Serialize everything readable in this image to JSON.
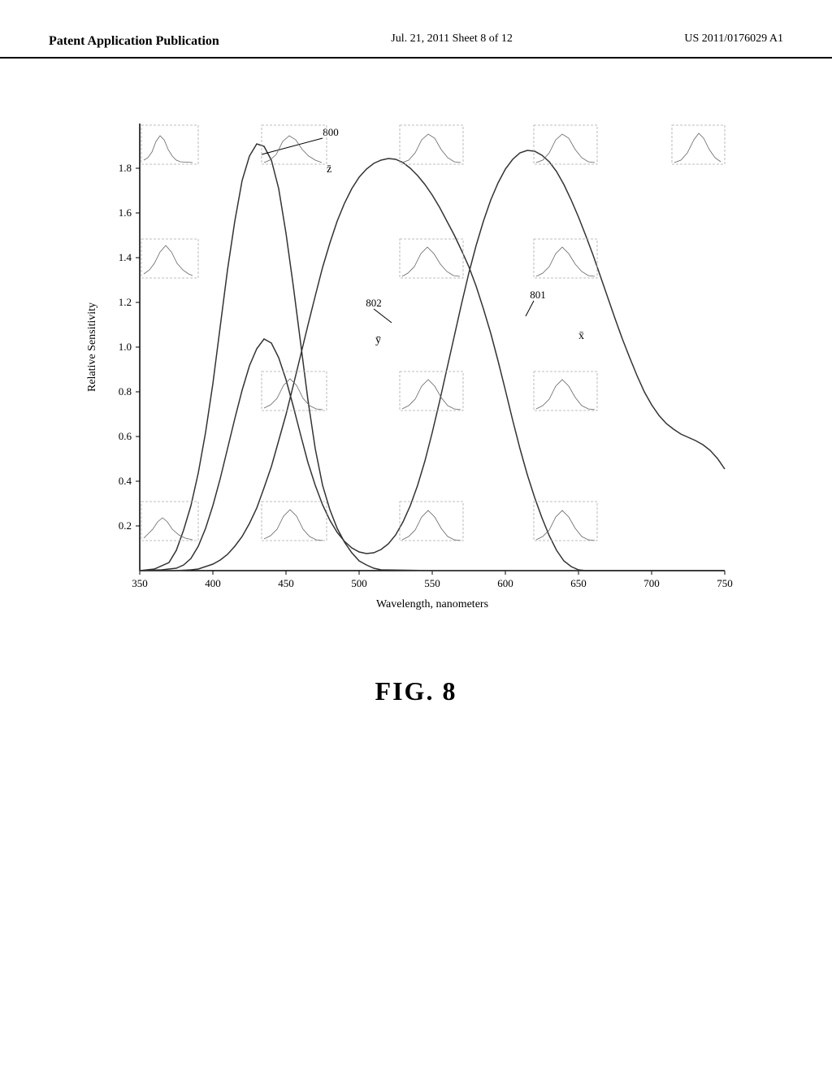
{
  "header": {
    "left": "Patent Application Publication",
    "center": "Jul. 21, 2011   Sheet 8 of 12",
    "right": "US 2011/0176029 A1"
  },
  "figure": {
    "label": "FIG. 8",
    "y_axis_label": "Relative Sensitivity",
    "x_axis_label": "Wavelength, nanometers",
    "y_ticks": [
      "0.2",
      "0.4",
      "0.6",
      "0.8",
      "1.0",
      "1.2",
      "1.4",
      "1.6",
      "1.8"
    ],
    "x_ticks": [
      "350",
      "400",
      "450",
      "500",
      "550",
      "600",
      "650",
      "700",
      "750"
    ],
    "annotations": {
      "label_800": "800",
      "label_801": "801",
      "label_802": "802",
      "label_z_bar": "z̄",
      "label_y_bar": "ȳ",
      "label_x_bar": "x̄"
    }
  }
}
